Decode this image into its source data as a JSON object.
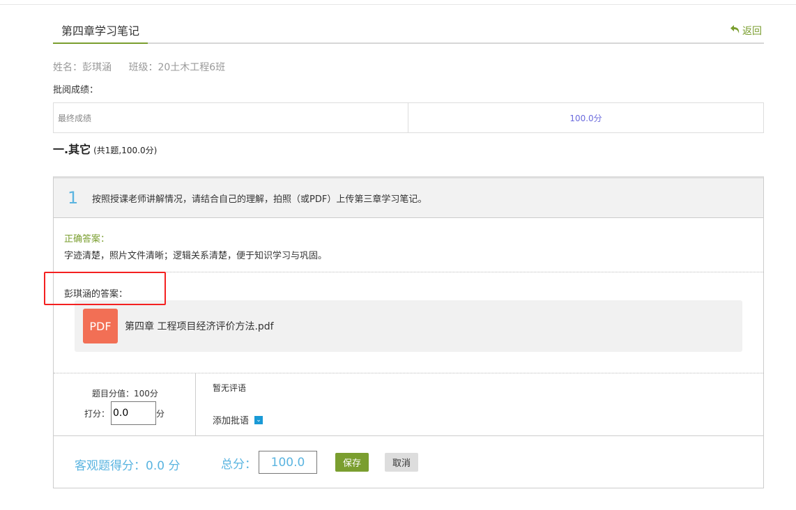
{
  "header": {
    "tab": "第四章学习笔记",
    "back": "返回"
  },
  "student": {
    "name": "姓名：彭琪涵",
    "class": "班级：20土木工程6班"
  },
  "grade": {
    "label": "批阅成绩：",
    "final_label": "最终成绩",
    "final_value": "100.0分"
  },
  "section": {
    "title": "一.其它",
    "summary": "(共1题,100.0分)"
  },
  "question": {
    "number": "1",
    "text": "按照授课老师讲解情况，请结合自己的理解，拍照（或PDF）上传第三章学习笔记。",
    "correct_label": "正确答案：",
    "correct_text": "字迹清楚，照片文件清晰；逻辑关系清楚，便于知识学习与巩固。",
    "answer_label": "彭琪涵的答案：",
    "file_icon": "PDF",
    "file_name": "第四章 工程项目经济评价方法.pdf"
  },
  "scoring": {
    "question_value": "题目分值：100分",
    "score_label": "打分：",
    "score_value": "0.0",
    "score_unit": "分",
    "no_comment": "暂无评语",
    "add_comment": "添加批语"
  },
  "footer": {
    "objective": "客观题得分：0.0 分",
    "total_label": "总分：",
    "total_value": "100.0",
    "save": "保存",
    "cancel": "取消"
  },
  "colors": {
    "accent": "#7a9e2f",
    "blue": "#5ab4e0",
    "highlight": "#f42020"
  }
}
